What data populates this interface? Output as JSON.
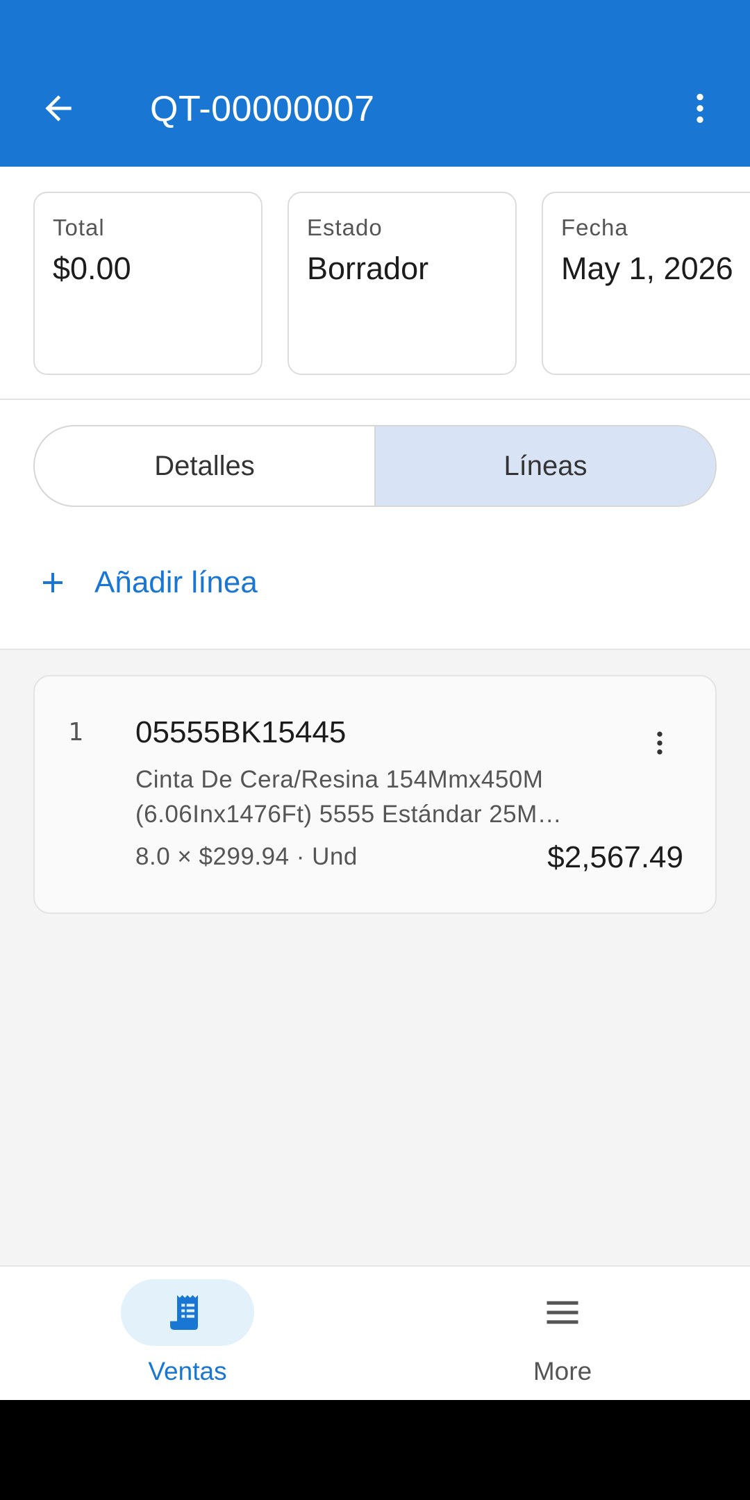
{
  "header": {
    "title": "QT-00000007",
    "back_icon": "arrow-left-icon",
    "more_icon": "more-vert-icon",
    "background": "#1976d2"
  },
  "summary": {
    "cards": [
      {
        "label": "Total",
        "value": "$0.00"
      },
      {
        "label": "Estado",
        "value": "Borrador"
      },
      {
        "label": "Fecha",
        "value": "May 1, 2026"
      }
    ]
  },
  "tabs": {
    "items": [
      {
        "label": "Detalles",
        "selected": false
      },
      {
        "label": "Líneas",
        "selected": true
      }
    ]
  },
  "add_line": {
    "label": "Añadir línea",
    "icon": "plus-icon"
  },
  "lines": [
    {
      "number": "1",
      "code": "05555BK15445",
      "description_line1": "Cinta De Cera/Resina 154Mmx450M",
      "description_line2": "(6.06Inx1476Ft) 5555 Estándar 25M…",
      "quantity_text": "8.0 × $299.94 · Und",
      "total": "$2,567.49"
    }
  ],
  "bottom_nav": {
    "items": [
      {
        "label": "Ventas",
        "icon": "receipt-icon",
        "active": true,
        "color": "#1976d2"
      },
      {
        "label": "More",
        "icon": "menu-icon",
        "active": false,
        "color": "#555555"
      }
    ]
  }
}
